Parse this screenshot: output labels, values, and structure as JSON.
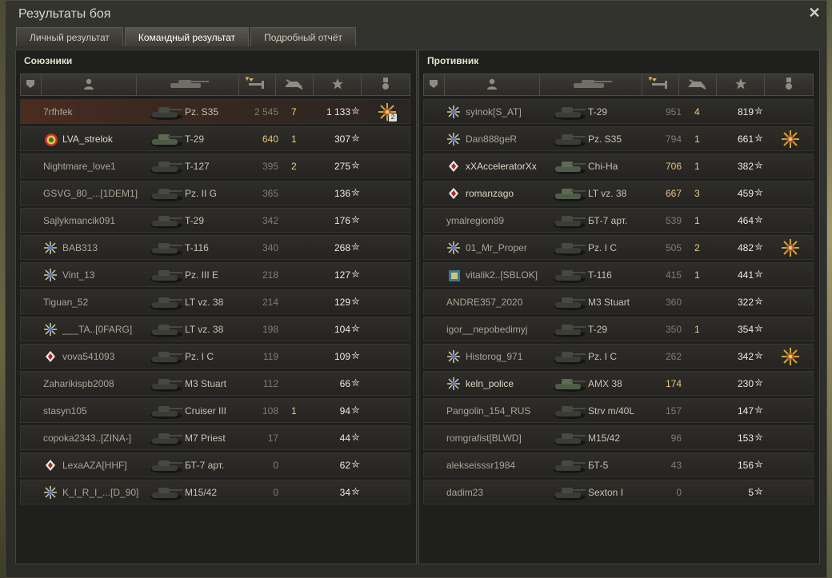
{
  "window": {
    "title": "Результаты боя"
  },
  "tabs": [
    {
      "label": "Личный результат",
      "active": false
    },
    {
      "label": "Командный результат",
      "active": true
    },
    {
      "label": "Подробный отчёт",
      "active": false
    }
  ],
  "header_icons": [
    "platoon-icon",
    "player-icon",
    "tank-icon",
    "damage-icon",
    "kills-icon",
    "xp-icon",
    "medal-icon"
  ],
  "allies": {
    "title": "Союзники",
    "rows": [
      {
        "player": "7rfhfek",
        "badge": "",
        "tank": "Pz. S35",
        "damage": "2 545",
        "kills": "7",
        "xp": "1 133",
        "medal": "medal",
        "medal_count": "2",
        "me": true,
        "alive": false
      },
      {
        "player": "LVA_strelok",
        "badge": "clan",
        "tank": "T-29",
        "damage": "640",
        "kills": "1",
        "xp": "307",
        "medal": "",
        "alive": true
      },
      {
        "player": "Nightmare_love1",
        "badge": "",
        "tank": "T-127",
        "damage": "395",
        "kills": "2",
        "xp": "275",
        "medal": "",
        "alive": false
      },
      {
        "player": "GSVG_80_...[1DEM1]",
        "badge": "",
        "tank": "Pz. II G",
        "damage": "365",
        "kills": "",
        "xp": "136",
        "medal": "",
        "alive": false
      },
      {
        "player": "Sajlykmancik091",
        "badge": "",
        "tank": "T-29",
        "damage": "342",
        "kills": "",
        "xp": "176",
        "medal": "",
        "alive": false
      },
      {
        "player": "BAB313",
        "badge": "star",
        "tank": "T-116",
        "damage": "340",
        "kills": "",
        "xp": "268",
        "medal": "",
        "alive": false
      },
      {
        "player": "Vint_13",
        "badge": "star",
        "tank": "Pz. III E",
        "damage": "218",
        "kills": "",
        "xp": "127",
        "medal": "",
        "alive": false
      },
      {
        "player": "Tiguan_52",
        "badge": "",
        "tank": "LT vz. 38",
        "damage": "214",
        "kills": "",
        "xp": "129",
        "medal": "",
        "alive": false
      },
      {
        "player": "___TA..[0FARG]",
        "badge": "star",
        "tank": "LT vz. 38",
        "damage": "198",
        "kills": "",
        "xp": "104",
        "medal": "",
        "alive": false
      },
      {
        "player": "vova541093",
        "badge": "diamond",
        "tank": "Pz. I C",
        "damage": "119",
        "kills": "",
        "xp": "109",
        "medal": "",
        "alive": false
      },
      {
        "player": "Zaharikispb2008",
        "badge": "",
        "tank": "M3 Stuart",
        "damage": "112",
        "kills": "",
        "xp": "66",
        "medal": "",
        "alive": false
      },
      {
        "player": "stasyn105",
        "badge": "",
        "tank": "Cruiser III",
        "damage": "108",
        "kills": "1",
        "xp": "94",
        "medal": "",
        "alive": false
      },
      {
        "player": "copoka2343..[ZINA-]",
        "badge": "",
        "tank": "M7 Priest",
        "damage": "17",
        "kills": "",
        "xp": "44",
        "medal": "",
        "alive": false
      },
      {
        "player": "LexaAZA[HHF]",
        "badge": "diamond",
        "tank": "БТ-7 арт.",
        "damage": "0",
        "kills": "",
        "xp": "62",
        "medal": "",
        "alive": false
      },
      {
        "player": "K_I_R_I_...[D_90]",
        "badge": "star",
        "tank": "M15/42",
        "damage": "0",
        "kills": "",
        "xp": "34",
        "medal": "",
        "alive": false
      }
    ]
  },
  "enemies": {
    "title": "Противник",
    "rows": [
      {
        "player": "syinok[S_AT]",
        "badge": "star",
        "tank": "T-29",
        "damage": "951",
        "kills": "4",
        "xp": "819",
        "medal": "",
        "alive": false
      },
      {
        "player": "Dan888geR",
        "badge": "star",
        "tank": "Pz. S35",
        "damage": "794",
        "kills": "1",
        "xp": "661",
        "medal": "medal",
        "alive": false
      },
      {
        "player": "xXAcceleratorXx",
        "badge": "diamond",
        "tank": "Chi-Ha",
        "damage": "706",
        "kills": "1",
        "xp": "382",
        "medal": "",
        "alive": true
      },
      {
        "player": "romanzago",
        "badge": "diamond",
        "tank": "LT vz. 38",
        "damage": "667",
        "kills": "3",
        "xp": "459",
        "medal": "",
        "alive": true
      },
      {
        "player": "ymalregion89",
        "badge": "",
        "tank": "БТ-7 арт.",
        "damage": "539",
        "kills": "1",
        "xp": "464",
        "medal": "",
        "alive": false
      },
      {
        "player": "01_Mr_Proper",
        "badge": "star",
        "tank": "Pz. I C",
        "damage": "505",
        "kills": "2",
        "xp": "482",
        "medal": "medal",
        "alive": false
      },
      {
        "player": "vitalik2..[SBLOK]",
        "badge": "clan2",
        "tank": "T-116",
        "damage": "415",
        "kills": "1",
        "xp": "441",
        "medal": "",
        "alive": false
      },
      {
        "player": "ANDRE357_2020",
        "badge": "",
        "tank": "M3 Stuart",
        "damage": "360",
        "kills": "",
        "xp": "322",
        "medal": "",
        "alive": false
      },
      {
        "player": "igor__nepobedimyj",
        "badge": "",
        "tank": "T-29",
        "damage": "350",
        "kills": "1",
        "xp": "354",
        "medal": "",
        "alive": false
      },
      {
        "player": "Historog_971",
        "badge": "star",
        "tank": "Pz. I C",
        "damage": "262",
        "kills": "",
        "xp": "342",
        "medal": "medal",
        "alive": false
      },
      {
        "player": "keln_police",
        "badge": "star",
        "tank": "AMX 38",
        "damage": "174",
        "kills": "",
        "xp": "230",
        "medal": "",
        "alive": true
      },
      {
        "player": "Pangolin_154_RUS",
        "badge": "",
        "tank": "Strv m/40L",
        "damage": "157",
        "kills": "",
        "xp": "147",
        "medal": "",
        "alive": false
      },
      {
        "player": "romgrafist[BLWD]",
        "badge": "",
        "tank": "M15/42",
        "damage": "96",
        "kills": "",
        "xp": "153",
        "medal": "",
        "alive": false
      },
      {
        "player": "alekseisssr1984",
        "badge": "",
        "tank": "БТ-5",
        "damage": "43",
        "kills": "",
        "xp": "156",
        "medal": "",
        "alive": false
      },
      {
        "player": "dadim23",
        "badge": "",
        "tank": "Sexton I",
        "damage": "0",
        "kills": "",
        "xp": "5",
        "medal": "",
        "alive": false
      }
    ]
  },
  "colors": {
    "accent_gold": "#e9cf78",
    "text": "#dcd8c8",
    "dead_text": "#a8a497"
  }
}
